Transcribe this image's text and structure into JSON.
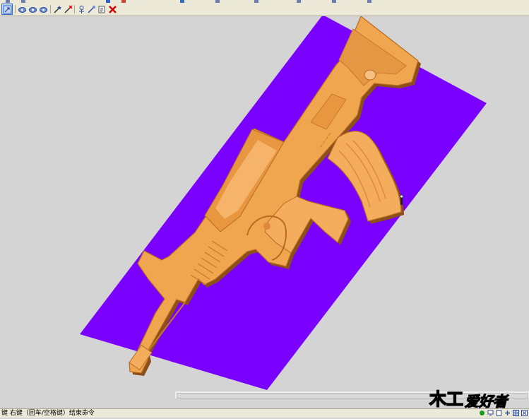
{
  "status": {
    "message": "键  右键（回车/空格键）结束命令"
  },
  "viewport": {
    "plane_color": "#7a00ff",
    "model_color": "#f0a54f",
    "background": "#d4d4d4"
  },
  "icons": {
    "toolbar": [
      "select-icon",
      "view-rotate-icon",
      "view-pan-icon",
      "view-zoom-icon",
      "wand-icon",
      "wand-delete-icon",
      "tool-path-icon",
      "tool-edit-icon",
      "layer-icon",
      "close-x-icon"
    ],
    "status": [
      "green-dot-icon",
      "monitor-icon",
      "page-icon",
      "plus-icon",
      "grid-icon",
      "fit-icon"
    ]
  },
  "watermark": {
    "text": "木工爱好者"
  }
}
